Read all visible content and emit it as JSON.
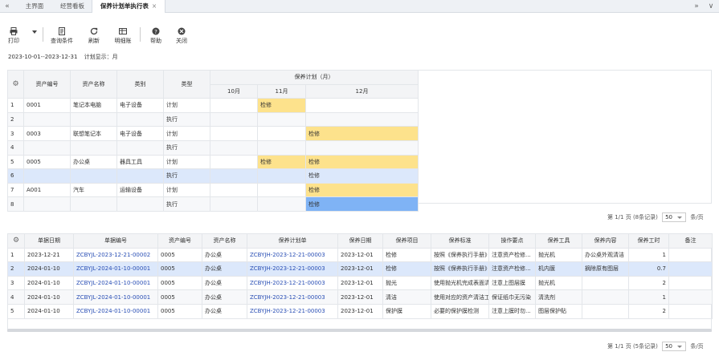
{
  "tabs": [
    {
      "label": "主界面"
    },
    {
      "label": "经营看板"
    },
    {
      "label": "保养计划单执行表",
      "close": "×"
    }
  ],
  "nav": {
    "left": "«",
    "right": "»",
    "more": "∨"
  },
  "toolbar": {
    "print": "打印",
    "query": "查询条件",
    "refresh": "刷新",
    "detail": "明细账",
    "help": "帮助",
    "close": "关闭"
  },
  "filter": {
    "date_range": "2023-10-01--2023-12-31",
    "display": "计划显示：月"
  },
  "plan_table": {
    "headers": {
      "asset_no": "资产编号",
      "asset_name": "资产名称",
      "category": "类别",
      "type": "类型",
      "plan_group": "保养计划（月）",
      "m10": "10月",
      "m11": "11月",
      "m12": "12月"
    },
    "rows": [
      {
        "n": "1",
        "asset_no": "0001",
        "asset_name": "笔记本电脑",
        "category": "电子设备",
        "type": "计划",
        "m10": "",
        "m11": "检修",
        "m12": ""
      },
      {
        "n": "2",
        "asset_no": "",
        "asset_name": "",
        "category": "",
        "type": "执行",
        "m10": "",
        "m11": "",
        "m12": ""
      },
      {
        "n": "3",
        "asset_no": "0003",
        "asset_name": "联想笔记本",
        "category": "电子设备",
        "type": "计划",
        "m10": "",
        "m11": "",
        "m12": "检修"
      },
      {
        "n": "4",
        "asset_no": "",
        "asset_name": "",
        "category": "",
        "type": "执行",
        "m10": "",
        "m11": "",
        "m12": ""
      },
      {
        "n": "5",
        "asset_no": "0005",
        "asset_name": "办公桌",
        "category": "器具工具",
        "type": "计划",
        "m10": "",
        "m11": "检修",
        "m12": "检修"
      },
      {
        "n": "6",
        "asset_no": "",
        "asset_name": "",
        "category": "",
        "type": "执行",
        "m10": "",
        "m11": "",
        "m12": "检修"
      },
      {
        "n": "7",
        "asset_no": "A001",
        "asset_name": "汽车",
        "category": "运输设备",
        "type": "计划",
        "m10": "",
        "m11": "",
        "m12": "检修"
      },
      {
        "n": "8",
        "asset_no": "",
        "asset_name": "",
        "category": "",
        "type": "执行",
        "m10": "",
        "m11": "",
        "m12": "检修"
      }
    ]
  },
  "pager1": {
    "text": "第 1/1 页 (8条记录)",
    "size": "50",
    "unit": "条/页"
  },
  "exec_table": {
    "headers": {
      "date": "单据日期",
      "doc_no": "单据编号",
      "asset_no": "资产编号",
      "asset_name": "资产名称",
      "plan_no": "保养计划单",
      "maint_date": "保养日期",
      "item": "保养项目",
      "standard": "保养标准",
      "points": "操作要点",
      "tool": "保养工具",
      "content": "保养内容",
      "hours": "保养工时",
      "remark": "备注"
    },
    "rows": [
      {
        "n": "1",
        "date": "2023-12-21",
        "doc_no": "ZCBYJL-2023-12-21-00002",
        "asset_no": "0005",
        "asset_name": "办公桌",
        "plan_no": "ZCBYJH-2023-12-21-00003",
        "maint_date": "2023-12-01",
        "item": "检修",
        "standard": "按照《保养执行手册》",
        "points": "注意资产检修...",
        "tool": "抛光机",
        "content": "办公桌外观清洁",
        "hours": "1",
        "remark": ""
      },
      {
        "n": "2",
        "date": "2024-01-10",
        "doc_no": "ZCBYJL-2024-01-10-00001",
        "asset_no": "0005",
        "asset_name": "办公桌",
        "plan_no": "ZCBYJH-2023-12-21-00003",
        "maint_date": "2023-12-01",
        "item": "检修",
        "standard": "按照《保养执行手册》",
        "points": "注意资产检修...",
        "tool": "机内膜",
        "content": "摘除原有图层",
        "hours": "0.7",
        "remark": ""
      },
      {
        "n": "3",
        "date": "2024-01-10",
        "doc_no": "ZCBYJL-2024-01-10-00001",
        "asset_no": "0005",
        "asset_name": "办公桌",
        "plan_no": "ZCBYJH-2023-12-21-00003",
        "maint_date": "2023-12-01",
        "item": "抛光",
        "standard": "使用抛光机完成表面清洁",
        "points": "注意上图层膜",
        "tool": "抛光机",
        "content": "",
        "hours": "2",
        "remark": ""
      },
      {
        "n": "4",
        "date": "2024-01-10",
        "doc_no": "ZCBYJL-2024-01-10-00001",
        "asset_no": "0005",
        "asset_name": "办公桌",
        "plan_no": "ZCBYJH-2023-12-21-00003",
        "maint_date": "2023-12-01",
        "item": "清洁",
        "standard": "使用对应的资产清洁工...",
        "points": "保证纸巾无污染",
        "tool": "清洗剂",
        "content": "",
        "hours": "1",
        "remark": ""
      },
      {
        "n": "5",
        "date": "2024-01-10",
        "doc_no": "ZCBYJL-2024-01-10-00001",
        "asset_no": "0005",
        "asset_name": "办公桌",
        "plan_no": "ZCBYJH-2023-12-21-00003",
        "maint_date": "2023-12-01",
        "item": "保护膜",
        "standard": "必要的保护膜检测",
        "points": "注意上膜时勿...",
        "tool": "图层保护贴",
        "content": "",
        "hours": "2",
        "remark": ""
      }
    ]
  },
  "pager2": {
    "text": "第 1/1 页 (5条记录)",
    "size": "50",
    "unit": "条/页"
  },
  "colors": {
    "plan_cell": "#fde28c",
    "exec_cell": "#7fb3f5",
    "selected_row": "#dce8fb",
    "link": "#2a4fb5"
  },
  "icons": {
    "print": "printer-icon",
    "query": "document-icon",
    "refresh": "refresh-icon",
    "detail": "ledger-icon",
    "help": "help-icon",
    "close": "close-circle-icon",
    "settings": "gear-icon"
  }
}
